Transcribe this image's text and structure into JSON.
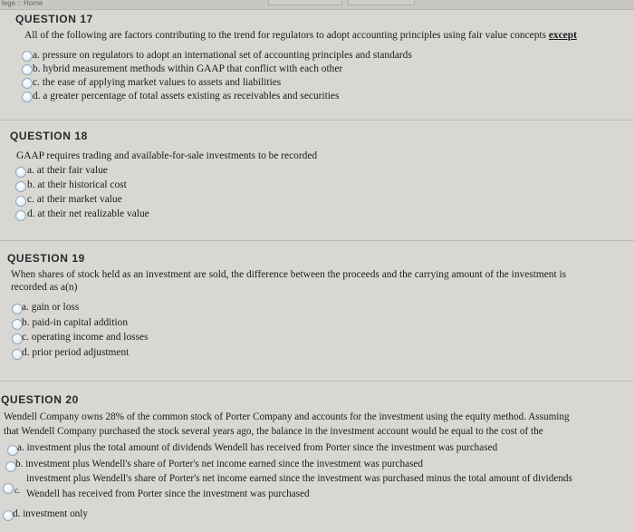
{
  "topbar": {
    "breadcrumb": "lege :: Home"
  },
  "questions": [
    {
      "header": "QUESTION 17",
      "text": "All of the following are factors contributing to the trend for regulators to adopt accounting principles using fair value concepts",
      "emphasis": "except",
      "options": [
        "a. pressure on regulators to adopt an international set of accounting principles and standards",
        "b. hybrid measurement methods within GAAP that conflict with each other",
        "c. the ease of applying market values to assets and liabilities",
        "d. a greater percentage of total assets existing as receivables and securities"
      ]
    },
    {
      "header": "QUESTION 18",
      "text": "GAAP requires trading and available-for-sale investments to be recorded",
      "options": [
        "a. at their fair value",
        "b. at their historical cost",
        "c. at their market value",
        "d. at their net realizable value"
      ]
    },
    {
      "header": "QUESTION 19",
      "text_line1": "When shares of stock held as an investment are sold, the difference between the proceeds and the carrying amount of the investment is",
      "text_line2": "recorded as a(n)",
      "options": [
        "a. gain or loss",
        "b. paid-in capital addition",
        "c. operating income and losses",
        "d. prior period adjustment"
      ]
    },
    {
      "header": "QUESTION 20",
      "text_line1": "Wendell Company owns 28% of the common stock of Porter Company and accounts for the investment using the equity method.  Assuming",
      "text_line2": "that Wendell Company purchased the stock several years ago, the balance in the investment account would be equal to the cost of the",
      "options": [
        "a. investment plus the total amount of dividends Wendell has received from Porter since the investment was purchased",
        "b. investment plus Wendell's share of Porter's net income earned since the investment was purchased"
      ],
      "option_c_line1": "investment plus Wendell's share of Porter's net income earned since the investment was purchased minus the total amount of dividends",
      "option_c_line2": "Wendell has received from Porter since the investment was purchased",
      "option_c_letter": "c.",
      "option_d": "d. investment only"
    }
  ]
}
